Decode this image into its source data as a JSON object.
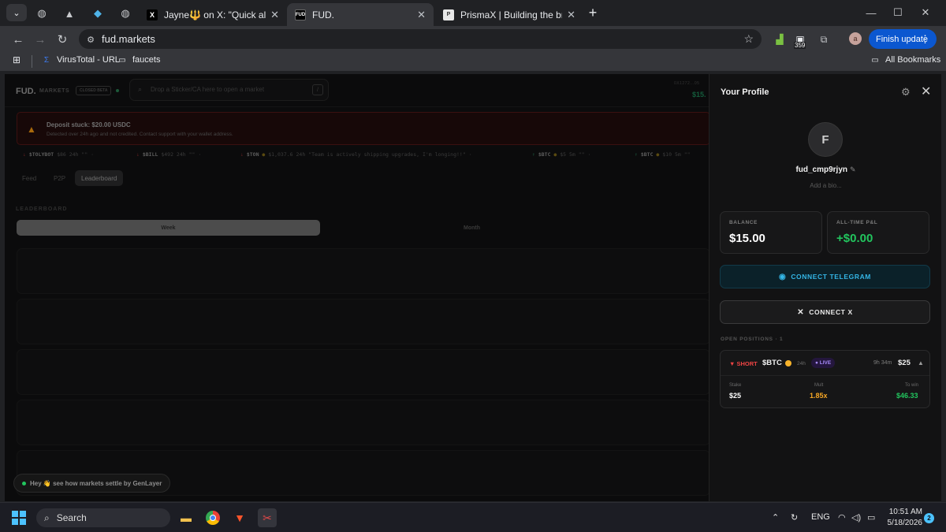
{
  "browser": {
    "tabs": [
      {
        "title": "Jayne🔱 on X: \"Quick alpha 🪂",
        "favicon": "x-logo"
      },
      {
        "title": "FUD.",
        "favicon": "fud-logo",
        "active": true
      },
      {
        "title": "PrismaX | Building the bridge b",
        "favicon": "prismax-logo"
      }
    ],
    "url": "fud.markets",
    "extension_badge": "359",
    "profile_initial": "a",
    "finish_update_label": "Finish update",
    "bookmarks": [
      {
        "label": "VirusTotal - URL",
        "icon": "virustotal-icon"
      },
      {
        "label": "faucets",
        "icon": "folder-icon"
      }
    ],
    "all_bookmarks_label": "All Bookmarks"
  },
  "app": {
    "brand": "FUD.",
    "brand_suffix": "MARKETS",
    "beta_label": "CLOSED BETA",
    "search_placeholder": "Drop a Sticker/CA here to open a market",
    "search_shortcut": "/",
    "wallet_address": "0X1272...05",
    "wallet_balance": "$15.",
    "alert": {
      "title": "Deposit stuck: $20.00 USDC",
      "description": "Detected over 24h ago and not credited. Contact support with your wallet address."
    },
    "ticker": [
      {
        "direction": "down",
        "symbol": "$TOLYBOT",
        "value": "$86",
        "duration": "24h",
        "quote": "\"\"",
        "tail": "·"
      },
      {
        "direction": "down",
        "symbol": "$BILL",
        "value": "$492",
        "duration": "24h",
        "quote": "\"\"",
        "tail": "·"
      },
      {
        "direction": "down",
        "symbol": "$TON",
        "value": "$1,037.6",
        "duration": "24h",
        "quote": "\"Team is actively shipping upgrades, I'm longing!!\"",
        "tail": "·"
      },
      {
        "direction": "up",
        "symbol": "$BTC",
        "value": "$5",
        "duration": "5m",
        "quote": "\"\"",
        "tail": "·"
      },
      {
        "direction": "up",
        "symbol": "$BTC",
        "value": "$10",
        "duration": "5m",
        "quote": "\"\"",
        "tail": ""
      }
    ],
    "nav_tabs": [
      "Feed",
      "P2P",
      "Leaderboard"
    ],
    "active_nav": "Leaderboard",
    "section_label": "LEADERBOARD",
    "periods": [
      "Week",
      "Month"
    ],
    "active_period": "Week",
    "toast": "Hey 👋 see how markets settle by GenLayer"
  },
  "profile": {
    "title": "Your Profile",
    "avatar_initial": "F",
    "username": "fud_cmp9rjyn",
    "bio_placeholder": "Add a bio...",
    "balance_label": "BALANCE",
    "balance_value": "$15.00",
    "pnl_label": "ALL-TIME P&L",
    "pnl_value": "+$0.00",
    "pnl_color": "#22c55e",
    "connect_telegram": "CONNECT TELEGRAM",
    "connect_x": "CONNECT X",
    "open_positions_label": "OPEN POSITIONS",
    "open_positions_count": "· 1",
    "position": {
      "side": "▼ SHORT",
      "symbol": "$BTC",
      "duration": "24h",
      "status": "● LIVE",
      "time_left": "9h 34m",
      "amount": "$25",
      "stake_label": "Stake",
      "stake_value": "$25",
      "mult_label": "Mult",
      "mult_value": "1.85x",
      "mult_color": "#f5a524",
      "towin_label": "To win",
      "towin_value": "$46.33",
      "towin_color": "#22c55e"
    }
  },
  "taskbar": {
    "search_label": "Search",
    "lang": "ENG",
    "time": "10:51 AM",
    "date": "5/18/2026",
    "notifications": "2"
  }
}
